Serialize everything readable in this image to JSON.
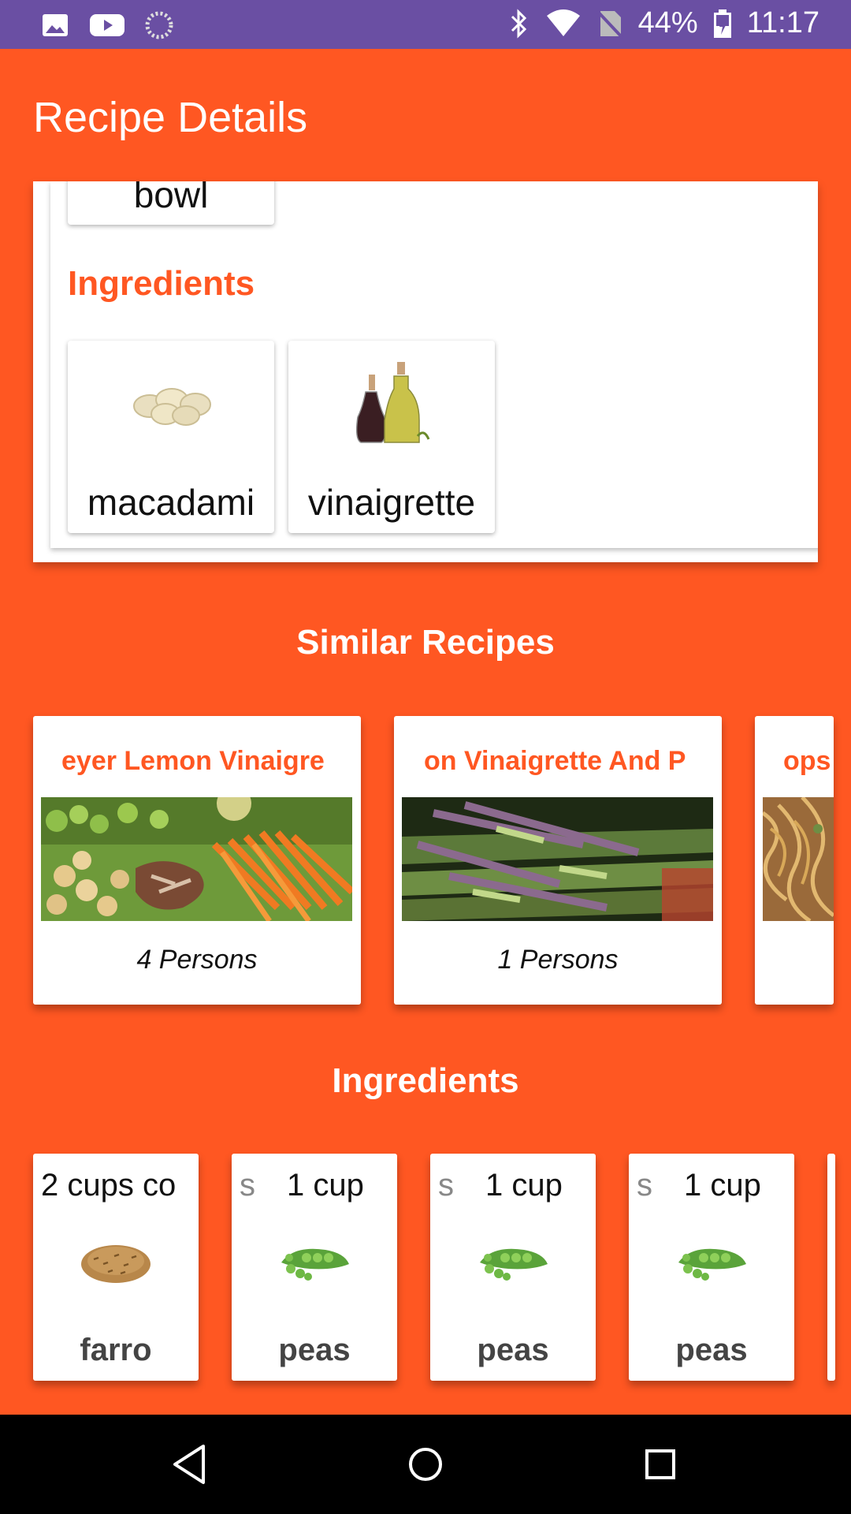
{
  "status_bar": {
    "battery": "44%",
    "time": "11:17",
    "icons": [
      "image-icon",
      "youtube-icon",
      "loading-icon",
      "bluetooth-icon",
      "wifi-icon",
      "no-sim-icon",
      "battery-icon"
    ]
  },
  "app_bar": {
    "title": "Recipe Details"
  },
  "equipment": {
    "partial_item": "bowl"
  },
  "ingredients_section": {
    "heading": "Ingredients",
    "items": [
      {
        "label": "macadami",
        "icon": "macadamia-icon"
      },
      {
        "label": "vinaigrette",
        "icon": "vinaigrette-icon"
      }
    ]
  },
  "similar_recipes": {
    "heading": "Similar Recipes",
    "cards": [
      {
        "title": "eyer Lemon Vinaigre",
        "persons": "4 Persons"
      },
      {
        "title": "on Vinaigrette And P",
        "persons": "1 Persons"
      },
      {
        "title": "ops",
        "persons": ""
      }
    ]
  },
  "ingredients_strip": {
    "heading": "Ingredients",
    "cards": [
      {
        "ghost": "",
        "qty": "2 cups co",
        "name": "farro"
      },
      {
        "ghost": "s",
        "qty": "1 cup",
        "name": "peas"
      },
      {
        "ghost": "s",
        "qty": "1 cup",
        "name": "peas"
      },
      {
        "ghost": "s",
        "qty": "1 cup",
        "name": "peas"
      }
    ]
  },
  "nav": {
    "icons": [
      "back-icon",
      "home-icon",
      "recents-icon"
    ]
  },
  "colors": {
    "accent": "#FF5722",
    "status_bar": "#6A4FA3"
  }
}
